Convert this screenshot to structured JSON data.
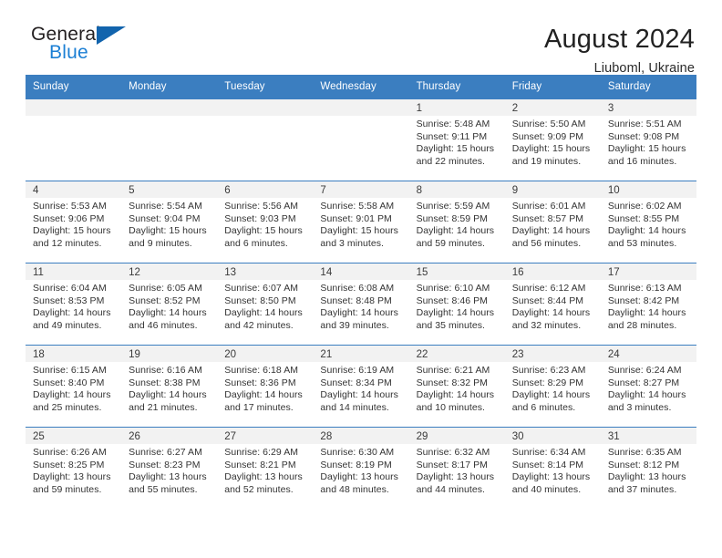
{
  "brand": {
    "name_top": "General",
    "name_bottom": "Blue",
    "mark": "triangle-logo-mark",
    "colors": {
      "blue": "#1b7fd4",
      "mark_blue": "#1264ad",
      "dark": "#231f20"
    }
  },
  "header": {
    "title": "August 2024",
    "subtitle": "Liuboml, Ukraine"
  },
  "calendar": {
    "header_color": "#3b7ec0",
    "band_color": "#f2f2f2",
    "weekdays": [
      "Sunday",
      "Monday",
      "Tuesday",
      "Wednesday",
      "Thursday",
      "Friday",
      "Saturday"
    ],
    "weeks": [
      [
        {
          "day": "",
          "sunrise": "",
          "sunset": "",
          "daylight_line1": "",
          "daylight_line2": ""
        },
        {
          "day": "",
          "sunrise": "",
          "sunset": "",
          "daylight_line1": "",
          "daylight_line2": ""
        },
        {
          "day": "",
          "sunrise": "",
          "sunset": "",
          "daylight_line1": "",
          "daylight_line2": ""
        },
        {
          "day": "",
          "sunrise": "",
          "sunset": "",
          "daylight_line1": "",
          "daylight_line2": ""
        },
        {
          "day": "1",
          "sunrise": "Sunrise: 5:48 AM",
          "sunset": "Sunset: 9:11 PM",
          "daylight_line1": "Daylight: 15 hours",
          "daylight_line2": "and 22 minutes."
        },
        {
          "day": "2",
          "sunrise": "Sunrise: 5:50 AM",
          "sunset": "Sunset: 9:09 PM",
          "daylight_line1": "Daylight: 15 hours",
          "daylight_line2": "and 19 minutes."
        },
        {
          "day": "3",
          "sunrise": "Sunrise: 5:51 AM",
          "sunset": "Sunset: 9:08 PM",
          "daylight_line1": "Daylight: 15 hours",
          "daylight_line2": "and 16 minutes."
        }
      ],
      [
        {
          "day": "4",
          "sunrise": "Sunrise: 5:53 AM",
          "sunset": "Sunset: 9:06 PM",
          "daylight_line1": "Daylight: 15 hours",
          "daylight_line2": "and 12 minutes."
        },
        {
          "day": "5",
          "sunrise": "Sunrise: 5:54 AM",
          "sunset": "Sunset: 9:04 PM",
          "daylight_line1": "Daylight: 15 hours",
          "daylight_line2": "and 9 minutes."
        },
        {
          "day": "6",
          "sunrise": "Sunrise: 5:56 AM",
          "sunset": "Sunset: 9:03 PM",
          "daylight_line1": "Daylight: 15 hours",
          "daylight_line2": "and 6 minutes."
        },
        {
          "day": "7",
          "sunrise": "Sunrise: 5:58 AM",
          "sunset": "Sunset: 9:01 PM",
          "daylight_line1": "Daylight: 15 hours",
          "daylight_line2": "and 3 minutes."
        },
        {
          "day": "8",
          "sunrise": "Sunrise: 5:59 AM",
          "sunset": "Sunset: 8:59 PM",
          "daylight_line1": "Daylight: 14 hours",
          "daylight_line2": "and 59 minutes."
        },
        {
          "day": "9",
          "sunrise": "Sunrise: 6:01 AM",
          "sunset": "Sunset: 8:57 PM",
          "daylight_line1": "Daylight: 14 hours",
          "daylight_line2": "and 56 minutes."
        },
        {
          "day": "10",
          "sunrise": "Sunrise: 6:02 AM",
          "sunset": "Sunset: 8:55 PM",
          "daylight_line1": "Daylight: 14 hours",
          "daylight_line2": "and 53 minutes."
        }
      ],
      [
        {
          "day": "11",
          "sunrise": "Sunrise: 6:04 AM",
          "sunset": "Sunset: 8:53 PM",
          "daylight_line1": "Daylight: 14 hours",
          "daylight_line2": "and 49 minutes."
        },
        {
          "day": "12",
          "sunrise": "Sunrise: 6:05 AM",
          "sunset": "Sunset: 8:52 PM",
          "daylight_line1": "Daylight: 14 hours",
          "daylight_line2": "and 46 minutes."
        },
        {
          "day": "13",
          "sunrise": "Sunrise: 6:07 AM",
          "sunset": "Sunset: 8:50 PM",
          "daylight_line1": "Daylight: 14 hours",
          "daylight_line2": "and 42 minutes."
        },
        {
          "day": "14",
          "sunrise": "Sunrise: 6:08 AM",
          "sunset": "Sunset: 8:48 PM",
          "daylight_line1": "Daylight: 14 hours",
          "daylight_line2": "and 39 minutes."
        },
        {
          "day": "15",
          "sunrise": "Sunrise: 6:10 AM",
          "sunset": "Sunset: 8:46 PM",
          "daylight_line1": "Daylight: 14 hours",
          "daylight_line2": "and 35 minutes."
        },
        {
          "day": "16",
          "sunrise": "Sunrise: 6:12 AM",
          "sunset": "Sunset: 8:44 PM",
          "daylight_line1": "Daylight: 14 hours",
          "daylight_line2": "and 32 minutes."
        },
        {
          "day": "17",
          "sunrise": "Sunrise: 6:13 AM",
          "sunset": "Sunset: 8:42 PM",
          "daylight_line1": "Daylight: 14 hours",
          "daylight_line2": "and 28 minutes."
        }
      ],
      [
        {
          "day": "18",
          "sunrise": "Sunrise: 6:15 AM",
          "sunset": "Sunset: 8:40 PM",
          "daylight_line1": "Daylight: 14 hours",
          "daylight_line2": "and 25 minutes."
        },
        {
          "day": "19",
          "sunrise": "Sunrise: 6:16 AM",
          "sunset": "Sunset: 8:38 PM",
          "daylight_line1": "Daylight: 14 hours",
          "daylight_line2": "and 21 minutes."
        },
        {
          "day": "20",
          "sunrise": "Sunrise: 6:18 AM",
          "sunset": "Sunset: 8:36 PM",
          "daylight_line1": "Daylight: 14 hours",
          "daylight_line2": "and 17 minutes."
        },
        {
          "day": "21",
          "sunrise": "Sunrise: 6:19 AM",
          "sunset": "Sunset: 8:34 PM",
          "daylight_line1": "Daylight: 14 hours",
          "daylight_line2": "and 14 minutes."
        },
        {
          "day": "22",
          "sunrise": "Sunrise: 6:21 AM",
          "sunset": "Sunset: 8:32 PM",
          "daylight_line1": "Daylight: 14 hours",
          "daylight_line2": "and 10 minutes."
        },
        {
          "day": "23",
          "sunrise": "Sunrise: 6:23 AM",
          "sunset": "Sunset: 8:29 PM",
          "daylight_line1": "Daylight: 14 hours",
          "daylight_line2": "and 6 minutes."
        },
        {
          "day": "24",
          "sunrise": "Sunrise: 6:24 AM",
          "sunset": "Sunset: 8:27 PM",
          "daylight_line1": "Daylight: 14 hours",
          "daylight_line2": "and 3 minutes."
        }
      ],
      [
        {
          "day": "25",
          "sunrise": "Sunrise: 6:26 AM",
          "sunset": "Sunset: 8:25 PM",
          "daylight_line1": "Daylight: 13 hours",
          "daylight_line2": "and 59 minutes."
        },
        {
          "day": "26",
          "sunrise": "Sunrise: 6:27 AM",
          "sunset": "Sunset: 8:23 PM",
          "daylight_line1": "Daylight: 13 hours",
          "daylight_line2": "and 55 minutes."
        },
        {
          "day": "27",
          "sunrise": "Sunrise: 6:29 AM",
          "sunset": "Sunset: 8:21 PM",
          "daylight_line1": "Daylight: 13 hours",
          "daylight_line2": "and 52 minutes."
        },
        {
          "day": "28",
          "sunrise": "Sunrise: 6:30 AM",
          "sunset": "Sunset: 8:19 PM",
          "daylight_line1": "Daylight: 13 hours",
          "daylight_line2": "and 48 minutes."
        },
        {
          "day": "29",
          "sunrise": "Sunrise: 6:32 AM",
          "sunset": "Sunset: 8:17 PM",
          "daylight_line1": "Daylight: 13 hours",
          "daylight_line2": "and 44 minutes."
        },
        {
          "day": "30",
          "sunrise": "Sunrise: 6:34 AM",
          "sunset": "Sunset: 8:14 PM",
          "daylight_line1": "Daylight: 13 hours",
          "daylight_line2": "and 40 minutes."
        },
        {
          "day": "31",
          "sunrise": "Sunrise: 6:35 AM",
          "sunset": "Sunset: 8:12 PM",
          "daylight_line1": "Daylight: 13 hours",
          "daylight_line2": "and 37 minutes."
        }
      ]
    ]
  }
}
